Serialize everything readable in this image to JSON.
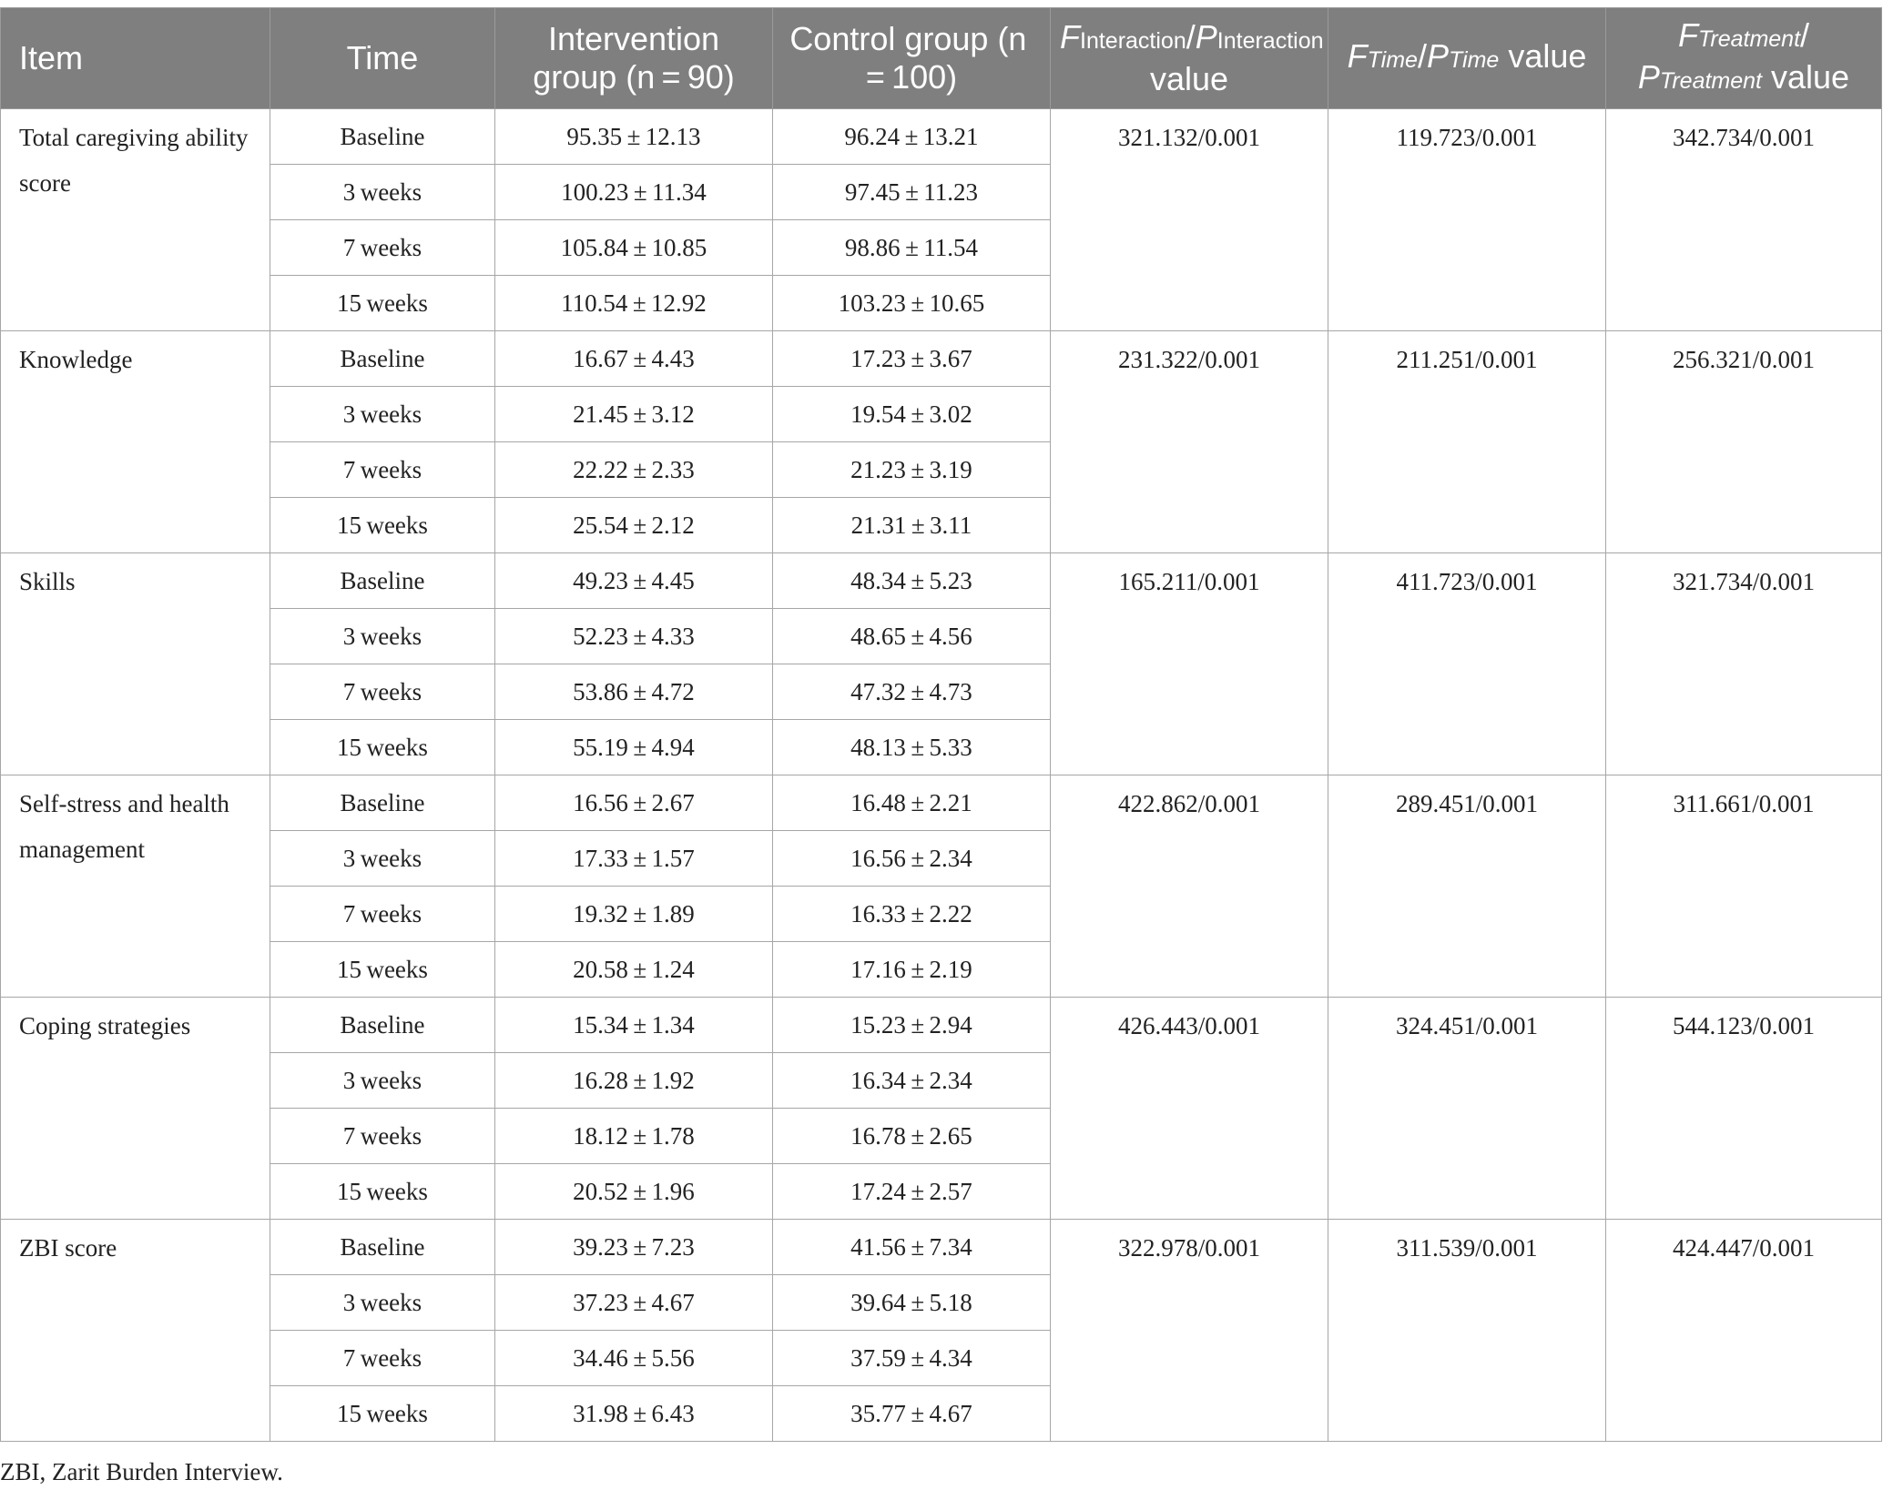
{
  "header": {
    "item": "Item",
    "time": "Time",
    "intervention": "Intervention group (n = 90)",
    "control": "Control group (n = 100)",
    "interaction": {
      "F": "F",
      "F_sub": "Interaction",
      "sep": "/",
      "P": "P",
      "P_sub": "Interaction",
      "suffix": "value"
    },
    "time_stat": {
      "F": "F",
      "F_sub": "Time",
      "sep": "/",
      "P": "P",
      "P_sub": "Time",
      "suffix": "value"
    },
    "treatment_stat": {
      "F": "F",
      "F_sub": "Treatment",
      "sep": "/",
      "P": "P",
      "P_sub": "Treatment",
      "suffix": "value"
    }
  },
  "rows": [
    {
      "item": "Total caregiving ability score",
      "interaction": "321.132/0.001",
      "time": "119.723/0.001",
      "treatment": "342.734/0.001",
      "timepoints": [
        {
          "time": "Baseline",
          "intervention": "95.35 ± 12.13",
          "control": "96.24 ± 13.21"
        },
        {
          "time": "3 weeks",
          "intervention": "100.23 ± 11.34",
          "control": "97.45 ± 11.23"
        },
        {
          "time": "7 weeks",
          "intervention": "105.84 ± 10.85",
          "control": "98.86 ± 11.54"
        },
        {
          "time": "15 weeks",
          "intervention": "110.54 ± 12.92",
          "control": "103.23 ± 10.65"
        }
      ]
    },
    {
      "item": "Knowledge",
      "interaction": "231.322/0.001",
      "time": "211.251/0.001",
      "treatment": "256.321/0.001",
      "timepoints": [
        {
          "time": "Baseline",
          "intervention": "16.67 ± 4.43",
          "control": "17.23 ± 3.67"
        },
        {
          "time": "3 weeks",
          "intervention": "21.45 ± 3.12",
          "control": "19.54 ± 3.02"
        },
        {
          "time": "7 weeks",
          "intervention": "22.22 ± 2.33",
          "control": "21.23 ± 3.19"
        },
        {
          "time": "15 weeks",
          "intervention": "25.54 ± 2.12",
          "control": "21.31 ± 3.11"
        }
      ]
    },
    {
      "item": "Skills",
      "interaction": "165.211/0.001",
      "time": "411.723/0.001",
      "treatment": "321.734/0.001",
      "timepoints": [
        {
          "time": "Baseline",
          "intervention": "49.23 ± 4.45",
          "control": "48.34 ± 5.23"
        },
        {
          "time": "3 weeks",
          "intervention": "52.23 ± 4.33",
          "control": "48.65 ± 4.56"
        },
        {
          "time": "7 weeks",
          "intervention": "53.86 ± 4.72",
          "control": "47.32 ± 4.73"
        },
        {
          "time": "15 weeks",
          "intervention": "55.19 ± 4.94",
          "control": "48.13 ± 5.33"
        }
      ]
    },
    {
      "item": "Self-stress and health management",
      "interaction": "422.862/0.001",
      "time": "289.451/0.001",
      "treatment": "311.661/0.001",
      "timepoints": [
        {
          "time": "Baseline",
          "intervention": "16.56 ± 2.67",
          "control": "16.48 ± 2.21"
        },
        {
          "time": "3 weeks",
          "intervention": "17.33 ± 1.57",
          "control": "16.56 ± 2.34"
        },
        {
          "time": "7 weeks",
          "intervention": "19.32 ± 1.89",
          "control": "16.33 ± 2.22"
        },
        {
          "time": "15 weeks",
          "intervention": "20.58 ± 1.24",
          "control": "17.16 ± 2.19"
        }
      ]
    },
    {
      "item": "Coping strategies",
      "interaction": "426.443/0.001",
      "time": "324.451/0.001",
      "treatment": "544.123/0.001",
      "timepoints": [
        {
          "time": "Baseline",
          "intervention": "15.34 ± 1.34",
          "control": "15.23 ± 2.94"
        },
        {
          "time": "3 weeks",
          "intervention": "16.28 ± 1.92",
          "control": "16.34 ± 2.34"
        },
        {
          "time": "7 weeks",
          "intervention": "18.12 ± 1.78",
          "control": "16.78 ± 2.65"
        },
        {
          "time": "15 weeks",
          "intervention": "20.52 ± 1.96",
          "control": "17.24 ± 2.57"
        }
      ]
    },
    {
      "item": "ZBI score",
      "interaction": "322.978/0.001",
      "time": "311.539/0.001",
      "treatment": "424.447/0.001",
      "timepoints": [
        {
          "time": "Baseline",
          "intervention": "39.23 ± 7.23",
          "control": "41.56 ± 7.34"
        },
        {
          "time": "3 weeks",
          "intervention": "37.23 ± 4.67",
          "control": "39.64 ± 5.18"
        },
        {
          "time": "7 weeks",
          "intervention": "34.46 ± 5.56",
          "control": "37.59 ± 4.34"
        },
        {
          "time": "15 weeks",
          "intervention": "31.98 ± 6.43",
          "control": "35.77 ± 4.67"
        }
      ]
    }
  ],
  "footnote": "ZBI, Zarit Burden Interview."
}
